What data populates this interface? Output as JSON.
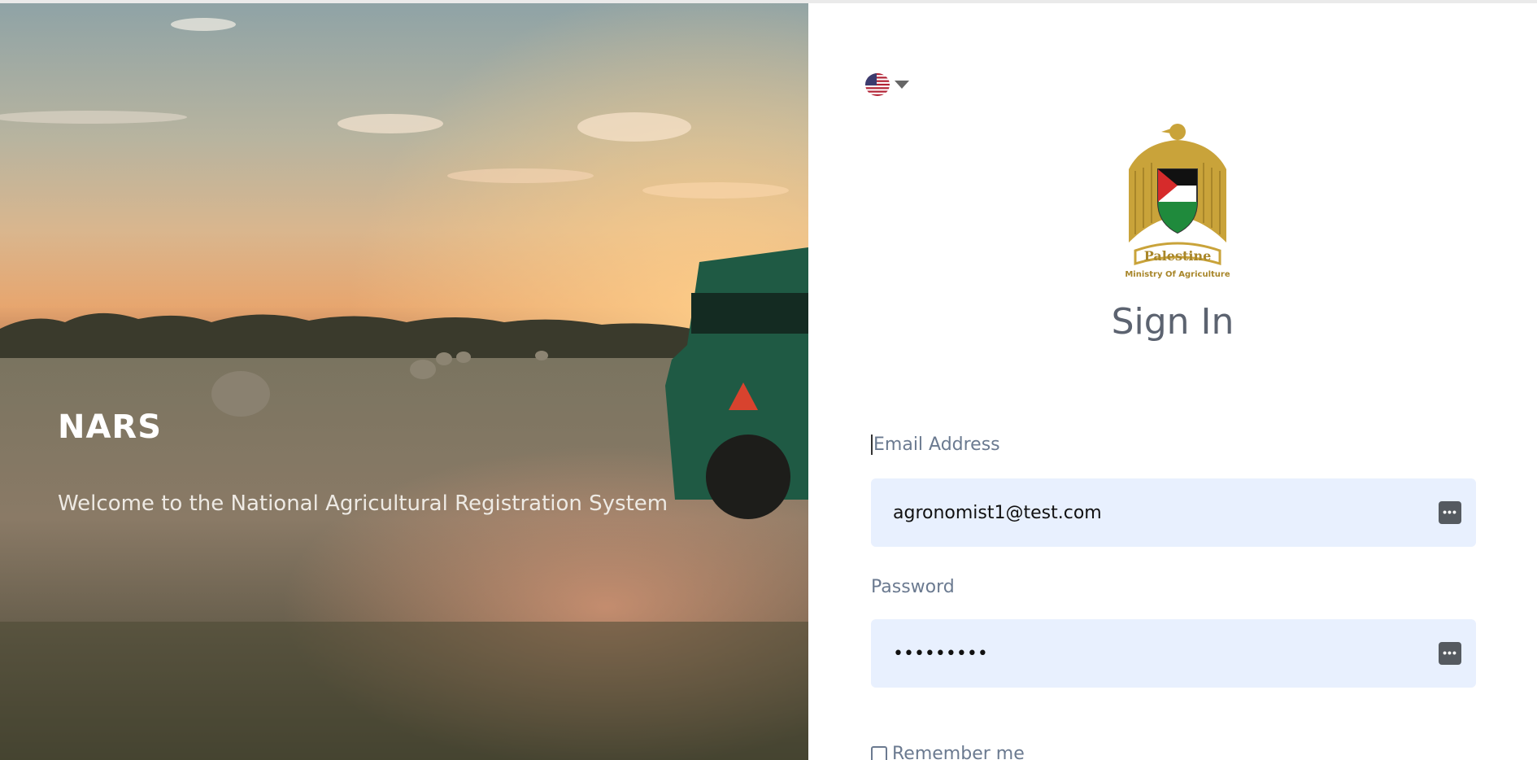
{
  "hero": {
    "title": "NARS",
    "subtitle": "Welcome to the National Agricultural Registration System"
  },
  "language": {
    "selected_icon": "us-flag-icon"
  },
  "emblem": {
    "country": "Palestine",
    "ministry": "Ministry Of Agriculture"
  },
  "form": {
    "title": "Sign In",
    "email_label": "Email Address",
    "email_value": "agronomist1@test.com",
    "password_label": "Password",
    "password_value": "•••••••••",
    "remember_label": "Remember me"
  },
  "colors": {
    "field_bg": "#e8f0fe",
    "label": "#6b7a90",
    "title": "#5c6370"
  }
}
